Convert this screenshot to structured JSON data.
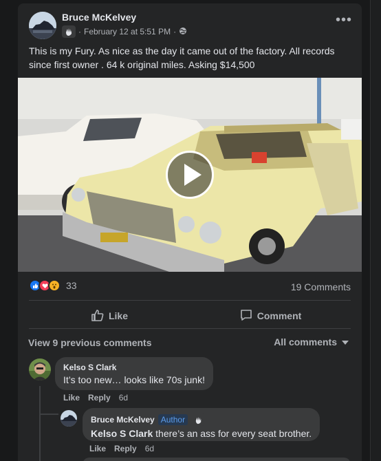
{
  "post": {
    "author": "Bruce McKelvey",
    "timestamp": "February 12 at 5:51 PM",
    "separator": "·",
    "text": "This is my Fury. As nice as the day it came out of the factory. All records since first owner . 64 k original miles. Asking $14,500",
    "more_label": "•••"
  },
  "stats": {
    "reaction_count": "33",
    "comments_label": "19 Comments"
  },
  "actions": {
    "like": "Like",
    "comment": "Comment"
  },
  "comments_section": {
    "view_previous": "View 9 previous comments",
    "filter_label": "All comments"
  },
  "comments": [
    {
      "author": "Kelso S Clark",
      "text": "It’s too new… looks like 70s junk!",
      "like": "Like",
      "reply": "Reply",
      "time": "6d"
    }
  ],
  "reply": {
    "author": "Bruce McKelvey",
    "badge": "Author",
    "mention": "Kelso S Clark",
    "text": " there’s an ass for every seat brother.",
    "like": "Like",
    "reply": "Reply",
    "time": "6d"
  },
  "colors": {
    "background": "#18191a",
    "card": "#242526",
    "bubble": "#3a3b3c",
    "secondary_text": "#b0b3b8",
    "like_blue": "#1877f2",
    "love_red": "#f33e58",
    "wow_yellow": "#f7b125"
  },
  "icons": [
    "globe-icon",
    "wave-icon",
    "play-icon",
    "like-reaction-icon",
    "love-reaction-icon",
    "wow-reaction-icon",
    "thumbs-up-icon",
    "comment-icon",
    "chevron-down-icon"
  ]
}
